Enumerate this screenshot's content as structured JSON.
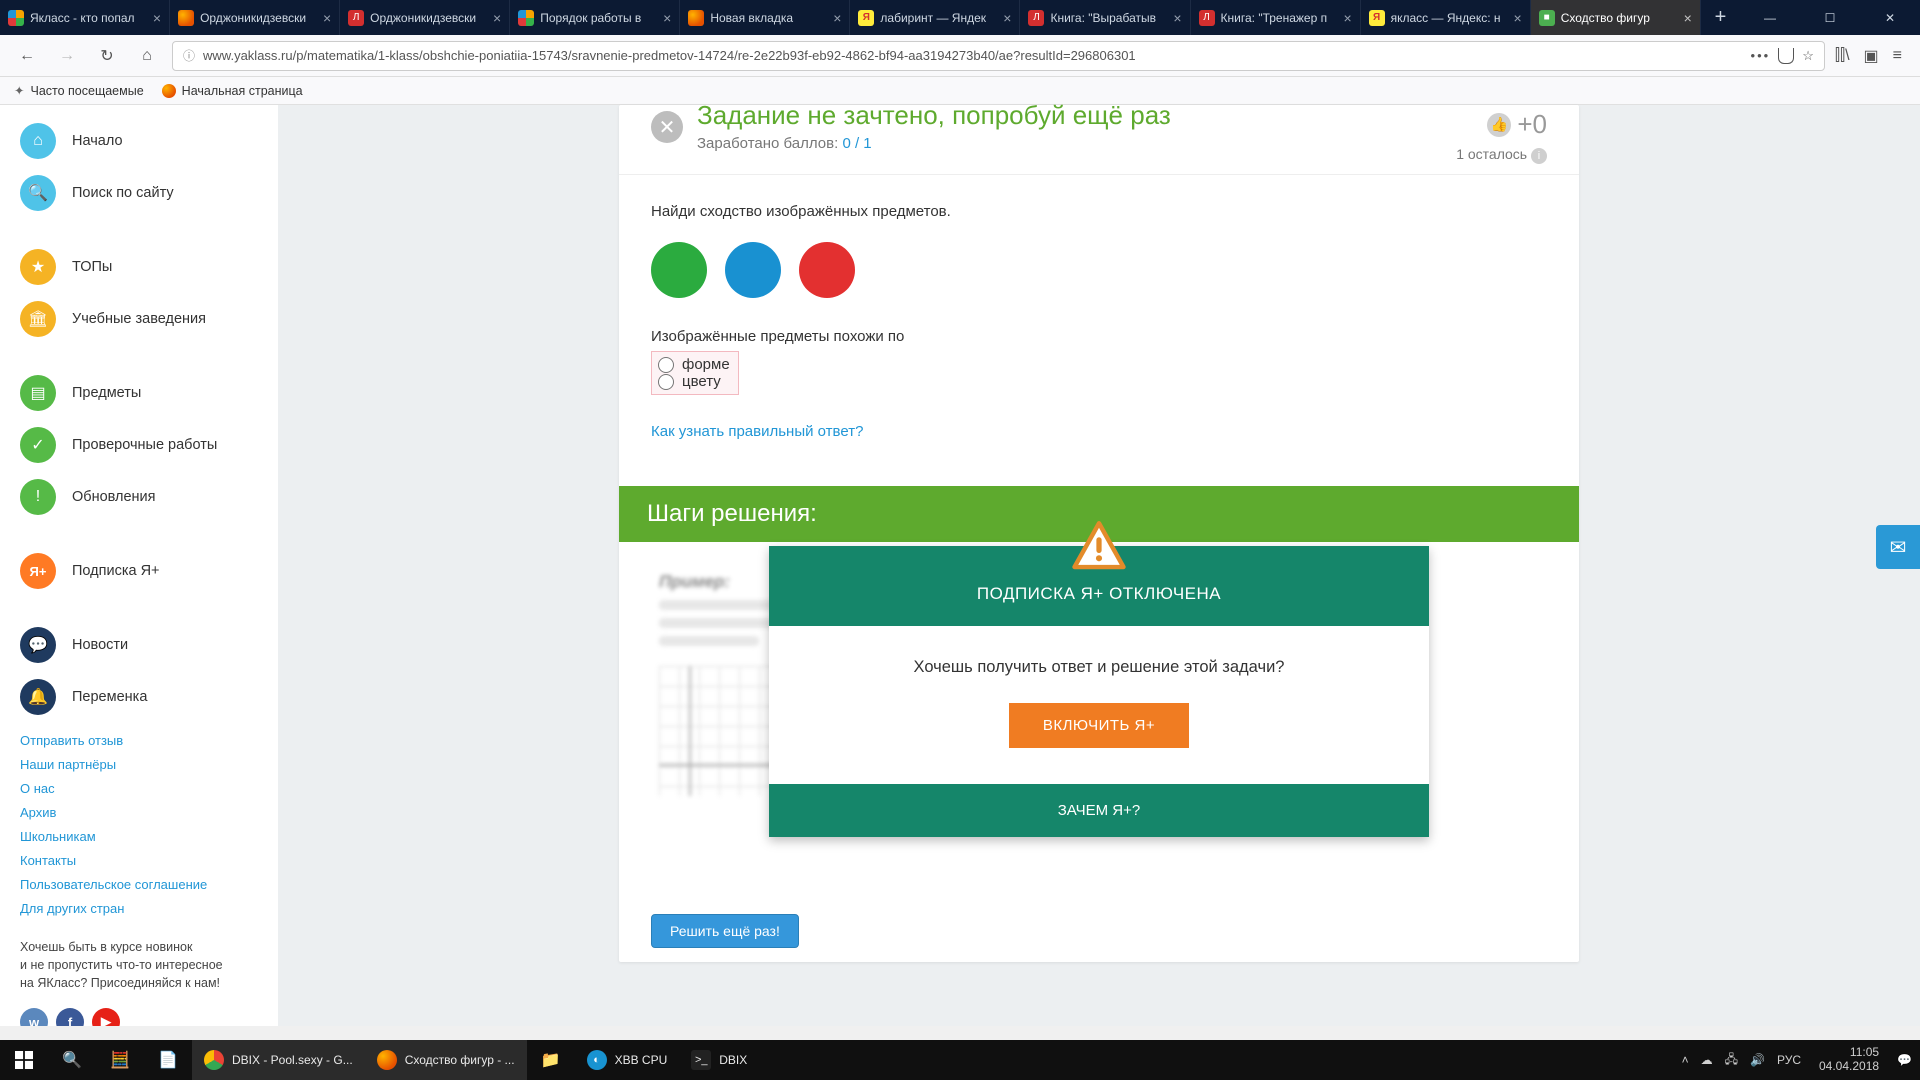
{
  "tabs": [
    {
      "label": "Якласс - кто попал"
    },
    {
      "label": "Орджоникидзевски"
    },
    {
      "label": "Орджоникидзевски"
    },
    {
      "label": "Порядок работы в"
    },
    {
      "label": "Новая вкладка"
    },
    {
      "label": "лабиринт — Яндек"
    },
    {
      "label": "Книга: \"Вырабатыв"
    },
    {
      "label": "Книга: \"Тренажер п"
    },
    {
      "label": "якласс — Яндекс: н"
    },
    {
      "label": "Сходство фигур"
    }
  ],
  "url": "www.yaklass.ru/p/matematika/1-klass/obshchie-poniatiia-15743/sravnenie-predmetov-14724/re-2e22b93f-eb92-4862-bf94-aa3194273b40/ae?resultId=296806301",
  "bookmarks": {
    "frequent": "Часто посещаемые",
    "start": "Начальная страница"
  },
  "sidebar": {
    "items": [
      {
        "label": "Начало"
      },
      {
        "label": "Поиск по сайту"
      },
      {
        "label": "ТОПы"
      },
      {
        "label": "Учебные заведения"
      },
      {
        "label": "Предметы"
      },
      {
        "label": "Проверочные работы"
      },
      {
        "label": "Обновления"
      },
      {
        "label": "Подписка Я+"
      },
      {
        "label": "Новости"
      },
      {
        "label": "Переменка"
      }
    ],
    "links": [
      "Отправить отзыв",
      "Наши партнёры",
      "О нас",
      "Архив",
      "Школьникам",
      "Контакты",
      "Пользовательское соглашение",
      "Для других стран"
    ],
    "promo": "Хочешь быть в курсе новинок\nи не пропустить что-то интересное\nна ЯКласс? Присоединяйся к нам!"
  },
  "task": {
    "title": "Задание не зачтено, попробуй ещё раз",
    "pts_label": "Заработано баллов:",
    "pts_score": "0 / 1",
    "hearts": "+0",
    "left": "1 осталось",
    "q1": "Найди сходство изображённых предметов.",
    "q2": "Изображённые предметы  похожи по",
    "opt1": "форме",
    "opt2": "цвету",
    "howto": "Как узнать правильный ответ?",
    "steps": "Шаги решения:",
    "blur_title": "Пример:",
    "retry": "Решить ещё раз!"
  },
  "modal": {
    "top": "ПОДПИСКА Я+ ОТКЛЮЧЕНА",
    "mid": "Хочешь получить ответ и решение этой задачи?",
    "btn": "ВКЛЮЧИТЬ Я+",
    "bot": "ЗАЧЕМ Я+?"
  },
  "taskbar": {
    "apps": [
      {
        "label": "DBIX - Pool.sexy - G..."
      },
      {
        "label": "Сходство фигур - ..."
      },
      {
        "label": ""
      },
      {
        "label": "XBB CPU"
      },
      {
        "label": "DBIX"
      }
    ],
    "lang": "РУС",
    "time": "11:05",
    "date": "04.04.2018"
  }
}
